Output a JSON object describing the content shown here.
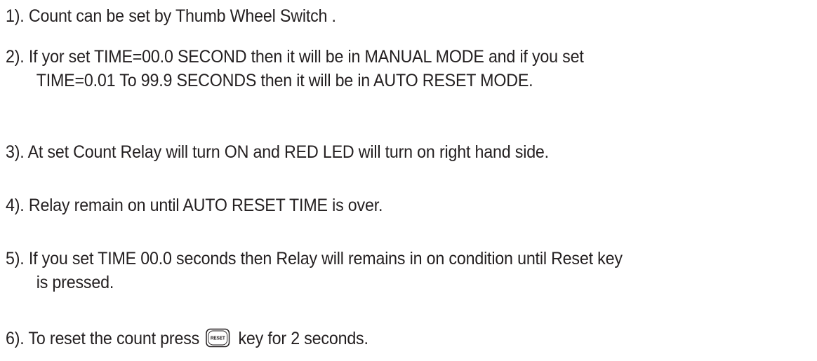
{
  "instructions": [
    {
      "lines": [
        "1).  Count can be set by Thumb Wheel Switch ."
      ]
    },
    {
      "lines": [
        "2).  If yor set TIME=00.0 SECOND then it will be in MANUAL MODE and if you set",
        "TIME=0.01 To 99.9 SECONDS then it will be in AUTO RESET MODE."
      ]
    },
    {
      "lines": [
        "3).  At set Count Relay will turn ON and RED LED will turn on right hand side."
      ]
    },
    {
      "lines": [
        "4).  Relay remain on until AUTO RESET TIME is over."
      ]
    },
    {
      "lines": [
        "5).  If you set TIME 00.0 seconds then Relay will remains in on condition until Reset key",
        "is pressed."
      ]
    },
    {
      "before_key": "6).  To reset the count press",
      "after_key": "key for 2 seconds.",
      "key_label": "RESET",
      "key_icon": "reset-key-icon"
    }
  ]
}
